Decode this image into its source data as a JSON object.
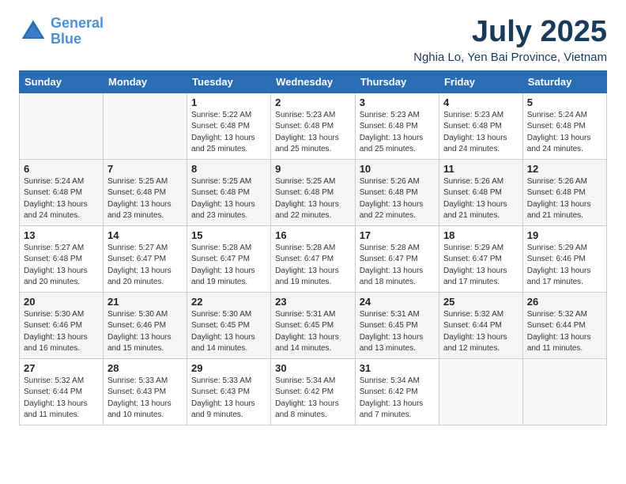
{
  "header": {
    "logo_line1": "General",
    "logo_line2": "Blue",
    "title": "July 2025",
    "subtitle": "Nghia Lo, Yen Bai Province, Vietnam"
  },
  "weekdays": [
    "Sunday",
    "Monday",
    "Tuesday",
    "Wednesday",
    "Thursday",
    "Friday",
    "Saturday"
  ],
  "weeks": [
    [
      {
        "day": "",
        "detail": ""
      },
      {
        "day": "",
        "detail": ""
      },
      {
        "day": "1",
        "detail": "Sunrise: 5:22 AM\nSunset: 6:48 PM\nDaylight: 13 hours and 25 minutes."
      },
      {
        "day": "2",
        "detail": "Sunrise: 5:23 AM\nSunset: 6:48 PM\nDaylight: 13 hours and 25 minutes."
      },
      {
        "day": "3",
        "detail": "Sunrise: 5:23 AM\nSunset: 6:48 PM\nDaylight: 13 hours and 25 minutes."
      },
      {
        "day": "4",
        "detail": "Sunrise: 5:23 AM\nSunset: 6:48 PM\nDaylight: 13 hours and 24 minutes."
      },
      {
        "day": "5",
        "detail": "Sunrise: 5:24 AM\nSunset: 6:48 PM\nDaylight: 13 hours and 24 minutes."
      }
    ],
    [
      {
        "day": "6",
        "detail": "Sunrise: 5:24 AM\nSunset: 6:48 PM\nDaylight: 13 hours and 24 minutes."
      },
      {
        "day": "7",
        "detail": "Sunrise: 5:25 AM\nSunset: 6:48 PM\nDaylight: 13 hours and 23 minutes."
      },
      {
        "day": "8",
        "detail": "Sunrise: 5:25 AM\nSunset: 6:48 PM\nDaylight: 13 hours and 23 minutes."
      },
      {
        "day": "9",
        "detail": "Sunrise: 5:25 AM\nSunset: 6:48 PM\nDaylight: 13 hours and 22 minutes."
      },
      {
        "day": "10",
        "detail": "Sunrise: 5:26 AM\nSunset: 6:48 PM\nDaylight: 13 hours and 22 minutes."
      },
      {
        "day": "11",
        "detail": "Sunrise: 5:26 AM\nSunset: 6:48 PM\nDaylight: 13 hours and 21 minutes."
      },
      {
        "day": "12",
        "detail": "Sunrise: 5:26 AM\nSunset: 6:48 PM\nDaylight: 13 hours and 21 minutes."
      }
    ],
    [
      {
        "day": "13",
        "detail": "Sunrise: 5:27 AM\nSunset: 6:48 PM\nDaylight: 13 hours and 20 minutes."
      },
      {
        "day": "14",
        "detail": "Sunrise: 5:27 AM\nSunset: 6:47 PM\nDaylight: 13 hours and 20 minutes."
      },
      {
        "day": "15",
        "detail": "Sunrise: 5:28 AM\nSunset: 6:47 PM\nDaylight: 13 hours and 19 minutes."
      },
      {
        "day": "16",
        "detail": "Sunrise: 5:28 AM\nSunset: 6:47 PM\nDaylight: 13 hours and 19 minutes."
      },
      {
        "day": "17",
        "detail": "Sunrise: 5:28 AM\nSunset: 6:47 PM\nDaylight: 13 hours and 18 minutes."
      },
      {
        "day": "18",
        "detail": "Sunrise: 5:29 AM\nSunset: 6:47 PM\nDaylight: 13 hours and 17 minutes."
      },
      {
        "day": "19",
        "detail": "Sunrise: 5:29 AM\nSunset: 6:46 PM\nDaylight: 13 hours and 17 minutes."
      }
    ],
    [
      {
        "day": "20",
        "detail": "Sunrise: 5:30 AM\nSunset: 6:46 PM\nDaylight: 13 hours and 16 minutes."
      },
      {
        "day": "21",
        "detail": "Sunrise: 5:30 AM\nSunset: 6:46 PM\nDaylight: 13 hours and 15 minutes."
      },
      {
        "day": "22",
        "detail": "Sunrise: 5:30 AM\nSunset: 6:45 PM\nDaylight: 13 hours and 14 minutes."
      },
      {
        "day": "23",
        "detail": "Sunrise: 5:31 AM\nSunset: 6:45 PM\nDaylight: 13 hours and 14 minutes."
      },
      {
        "day": "24",
        "detail": "Sunrise: 5:31 AM\nSunset: 6:45 PM\nDaylight: 13 hours and 13 minutes."
      },
      {
        "day": "25",
        "detail": "Sunrise: 5:32 AM\nSunset: 6:44 PM\nDaylight: 13 hours and 12 minutes."
      },
      {
        "day": "26",
        "detail": "Sunrise: 5:32 AM\nSunset: 6:44 PM\nDaylight: 13 hours and 11 minutes."
      }
    ],
    [
      {
        "day": "27",
        "detail": "Sunrise: 5:32 AM\nSunset: 6:44 PM\nDaylight: 13 hours and 11 minutes."
      },
      {
        "day": "28",
        "detail": "Sunrise: 5:33 AM\nSunset: 6:43 PM\nDaylight: 13 hours and 10 minutes."
      },
      {
        "day": "29",
        "detail": "Sunrise: 5:33 AM\nSunset: 6:43 PM\nDaylight: 13 hours and 9 minutes."
      },
      {
        "day": "30",
        "detail": "Sunrise: 5:34 AM\nSunset: 6:42 PM\nDaylight: 13 hours and 8 minutes."
      },
      {
        "day": "31",
        "detail": "Sunrise: 5:34 AM\nSunset: 6:42 PM\nDaylight: 13 hours and 7 minutes."
      },
      {
        "day": "",
        "detail": ""
      },
      {
        "day": "",
        "detail": ""
      }
    ]
  ]
}
